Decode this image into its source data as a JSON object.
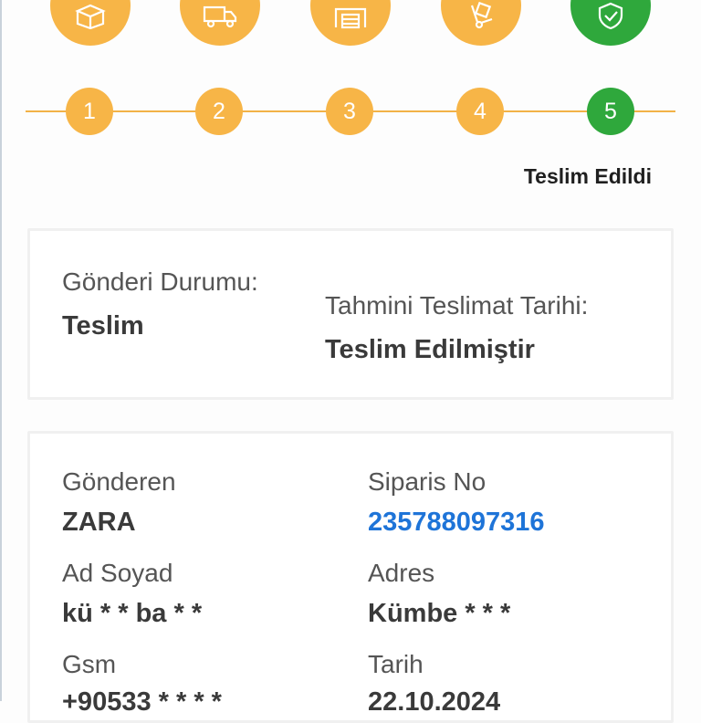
{
  "colors": {
    "step_pending": "#f7b547",
    "step_done": "#2fa83c",
    "link": "#1e74d8"
  },
  "stepper": {
    "icons": [
      {
        "name": "package-box-icon",
        "status": "pending"
      },
      {
        "name": "delivery-truck-icon",
        "status": "pending"
      },
      {
        "name": "warehouse-icon",
        "status": "pending"
      },
      {
        "name": "hand-truck-icon",
        "status": "pending"
      },
      {
        "name": "shield-check-icon",
        "status": "done"
      }
    ],
    "steps": [
      "1",
      "2",
      "3",
      "4",
      "5"
    ],
    "current_label": "Teslim Edildi"
  },
  "status_card": {
    "shipment_status_label": "Gönderi Durumu:",
    "shipment_status_value": "Teslim",
    "estimated_delivery_label": "Tahmini Teslimat Tarihi:",
    "estimated_delivery_value": "Teslim Edilmiştir"
  },
  "details_card": {
    "sender_label": "Gönderen",
    "sender_value": "ZARA",
    "order_no_label": "Siparis No",
    "order_no_value": "235788097316",
    "name_label": "Ad Soyad",
    "name_value": "kü * * ba * *",
    "address_label": "Adres",
    "address_value": "Kümbe * * *",
    "gsm_label": "Gsm",
    "gsm_value": "+90533 * * * *",
    "date_label": "Tarih",
    "date_value": "22.10.2024"
  }
}
